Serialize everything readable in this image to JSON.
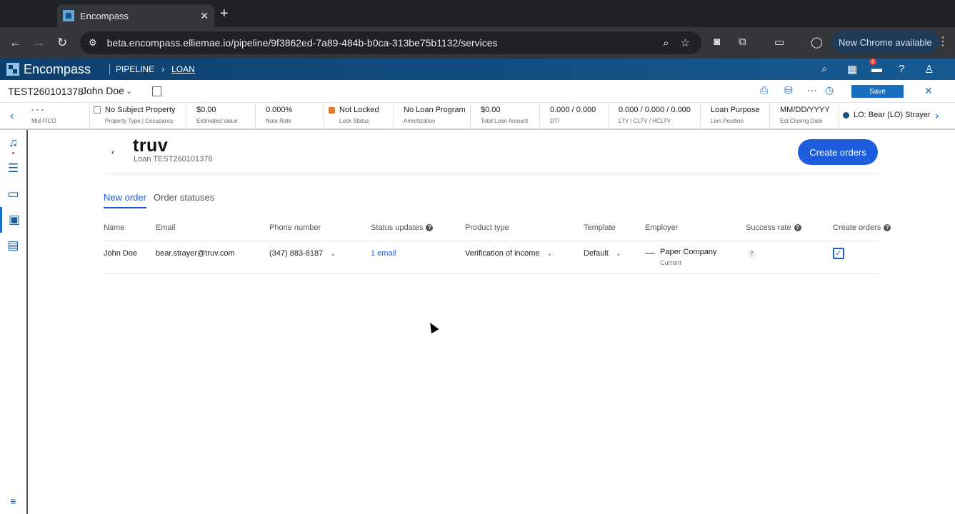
{
  "browser": {
    "tab_title": "Encompass",
    "tab_close": "✕",
    "new_tab": "+",
    "url": "beta.encompass.elliemae.io/pipeline/9f3862ed-7a89-484b-b0ca-313be75b1132/services",
    "new_chrome_label": "New Chrome available"
  },
  "header": {
    "logo_text": "Encompass",
    "breadcrumb": [
      "PIPELINE",
      "LOAN"
    ],
    "notification_count": "6"
  },
  "loan_bar": {
    "loan_id": "TEST260101378",
    "borrower": "John Doe",
    "save_label": "Save"
  },
  "data_strip": [
    {
      "value": "- - -",
      "label": "Mid-FICO"
    },
    {
      "value": "No Subject Property",
      "label": "Property Type | Occupancy"
    },
    {
      "value": "$0.00",
      "label": "Estimated Value"
    },
    {
      "value": "0.000%",
      "label": "Note Rate"
    },
    {
      "value": "Not Locked",
      "label": "Lock Status"
    },
    {
      "value": "No Loan Program",
      "label": "Amortization"
    },
    {
      "value": "$0.00",
      "label": "Total Loan Amount"
    },
    {
      "value": "0.000 / 0.000",
      "label": "DTI"
    },
    {
      "value": "0.000 / 0.000 / 0.000",
      "label": "LTV / CLTV / HCLTV"
    },
    {
      "value": "Loan Purpose",
      "label": "Lien Position"
    },
    {
      "value": "MM/DD/YYYY",
      "label": "Est Closing Date"
    },
    {
      "value": "LO: Bear (LO) Strayer",
      "label": ""
    }
  ],
  "service": {
    "logo": "truv",
    "loan_sub": "Loan TEST260101378",
    "create_orders_label": "Create orders",
    "tabs": [
      "New order",
      "Order statuses"
    ]
  },
  "table": {
    "headers": [
      "Name",
      "Email",
      "Phone number",
      "Status updates",
      "Product type",
      "Template",
      "Employer",
      "Success rate",
      "Create orders"
    ],
    "row": {
      "name": "John Doe",
      "email": "bear.strayer@truv.com",
      "phone": "(347) 883-8187",
      "status_updates": "1 email",
      "product_type": "Verification of income",
      "template": "Default",
      "employer_name": "Paper Company",
      "employer_status": "Current",
      "success_rate": "?",
      "create_orders_checked": "✓"
    }
  },
  "colors": {
    "accent": "#1d5cdb",
    "header_bg": "#0d3f6e",
    "lock": "#e07a2e"
  }
}
